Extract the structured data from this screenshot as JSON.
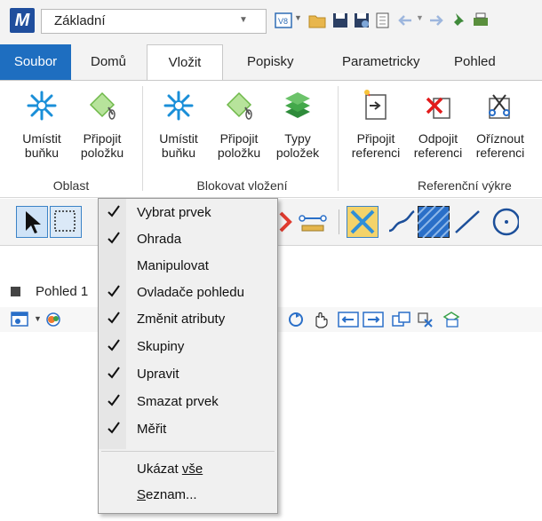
{
  "quick_access": {
    "workflow": "Základní"
  },
  "tabs": [
    {
      "label": "Soubor"
    },
    {
      "label": "Domů"
    },
    {
      "label": "Vložit"
    },
    {
      "label": "Popisky"
    },
    {
      "label": "Parametricky"
    },
    {
      "label": "Pohled"
    }
  ],
  "ribbon": {
    "buttons": [
      {
        "label": "Umístit\nbuňku"
      },
      {
        "label": "Připojit\npoložku"
      },
      {
        "label": "Umístit\nbuňku"
      },
      {
        "label": "Připojit\npoložku"
      },
      {
        "label": "Typy\npoložek"
      },
      {
        "label": "Připojit\nreferenci"
      },
      {
        "label": "Odpojit\nreferenci"
      },
      {
        "label": "Oříznout\nreferenci"
      }
    ],
    "groups": [
      {
        "label": "Oblast"
      },
      {
        "label": "Blokovat vložení"
      },
      {
        "label": "Referenční výkre"
      }
    ]
  },
  "view": {
    "tab_label": "Pohled 1"
  },
  "context_menu": {
    "items": [
      {
        "label": "Vybrat prvek",
        "checked": true
      },
      {
        "label": "Ohrada",
        "checked": true
      },
      {
        "label": "Manipulovat",
        "checked": false
      },
      {
        "label": "Ovladače pohledu",
        "checked": true
      },
      {
        "label": "Změnit atributy",
        "checked": true
      },
      {
        "label": "Skupiny",
        "checked": true
      },
      {
        "label": "Upravit",
        "checked": true
      },
      {
        "label": "Smazat prvek",
        "checked": true
      },
      {
        "label": "Měřit",
        "checked": true
      }
    ],
    "show_all_prefix": "Ukázat ",
    "show_all_underlined": "vše",
    "list_underlined": "S",
    "list_rest": "eznam..."
  },
  "colors": {
    "file_tab": "#1e6ec0",
    "accent_blue": "#1f4e9d"
  }
}
